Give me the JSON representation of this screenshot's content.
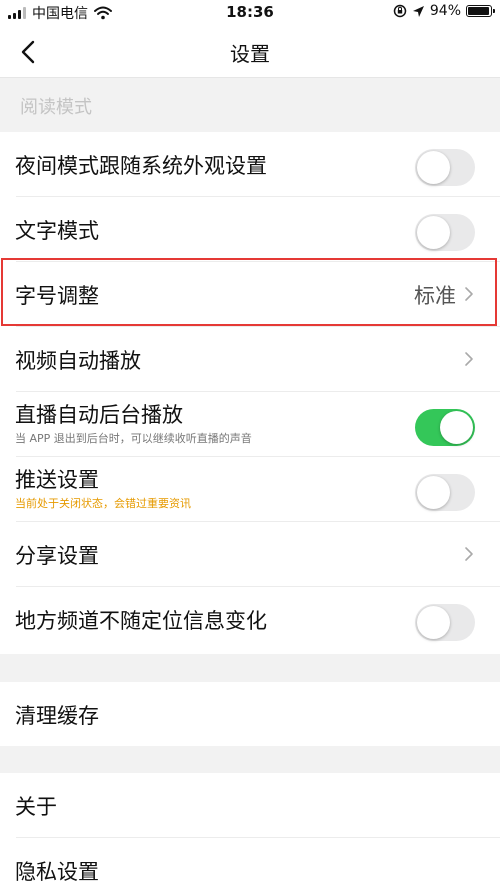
{
  "status_bar": {
    "carrier": "中国电信",
    "time": "18:36",
    "battery": "94%",
    "battery_level": 0.94
  },
  "nav": {
    "title": "设置"
  },
  "section": {
    "reading_mode": "阅读模式"
  },
  "rows": {
    "night_mode": {
      "title": "夜间模式跟随系统外观设置",
      "on": false
    },
    "text_mode": {
      "title": "文字模式",
      "on": false
    },
    "font_size": {
      "title": "字号调整",
      "value": "标准"
    },
    "video_autoplay": {
      "title": "视频自动播放"
    },
    "live_background": {
      "title": "直播自动后台播放",
      "sub": "当 APP 退出到后台时，可以继续收听直播的声音",
      "on": true
    },
    "push": {
      "title": "推送设置",
      "sub": "当前处于关闭状态，会错过重要资讯",
      "on": false
    },
    "share": {
      "title": "分享设置"
    },
    "local_channel": {
      "title": "地方频道不随定位信息变化",
      "on": false
    },
    "clear_cache": {
      "title": "清理缓存"
    },
    "about": {
      "title": "关于"
    },
    "privacy": {
      "title": "隐私设置"
    }
  },
  "colors": {
    "toggle_on": "#34c759",
    "toggle_off": "#e9e9ea",
    "warning_text": "#e69a00",
    "highlight": "#e53935"
  }
}
